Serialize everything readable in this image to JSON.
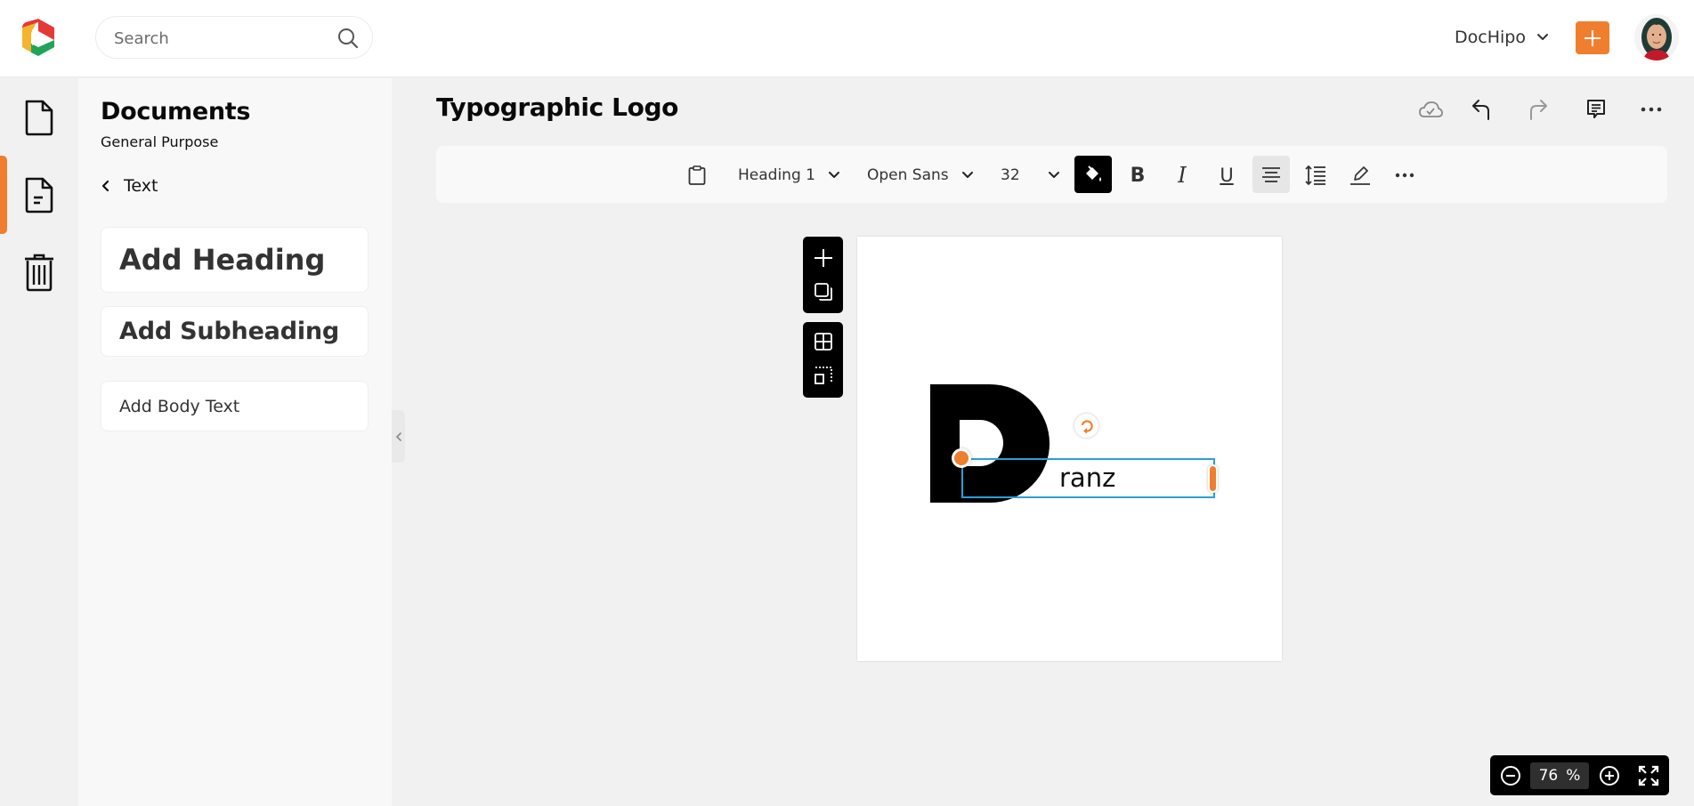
{
  "header": {
    "app_name": "DocHipo",
    "search_placeholder": "Search",
    "workspace_label": "DocHipo",
    "add_button_label": "+",
    "brand_colors": {
      "red": "#e53935",
      "yellow": "#f4b42c",
      "green": "#21a45a",
      "accent": "#ef7f2e"
    }
  },
  "rail": {
    "items": [
      {
        "name": "documents",
        "icon": "file-icon",
        "active": false
      },
      {
        "name": "templates",
        "icon": "file-text-icon",
        "active": true
      },
      {
        "name": "trash",
        "icon": "trash-icon",
        "active": false
      }
    ]
  },
  "panel": {
    "title": "Documents",
    "subtitle": "General Purpose",
    "back_label": "Text",
    "cards": [
      {
        "label": "Add Heading"
      },
      {
        "label": "Add Subheading"
      },
      {
        "label": "Add Body Text"
      }
    ]
  },
  "main": {
    "title": "Typographic Logo",
    "actions": [
      {
        "name": "cloud-saved",
        "icon": "cloud-check-icon"
      },
      {
        "name": "undo",
        "icon": "undo-icon"
      },
      {
        "name": "redo",
        "icon": "redo-icon",
        "disabled": true
      },
      {
        "name": "comments",
        "icon": "comment-icon"
      },
      {
        "name": "more",
        "icon": "more-horizontal-icon"
      }
    ]
  },
  "toolbar": {
    "paste_icon": "clipboard-icon",
    "text_style": "Heading 1",
    "font_family": "Open Sans",
    "font_size": "32",
    "fill_color_active": true,
    "bold": "B",
    "italic": "I",
    "underline": "U",
    "align": "center",
    "line_spacing_icon": "line-height-icon",
    "highlight_icon": "pen-icon",
    "more_icon": "more-horizontal-icon"
  },
  "canvas": {
    "logo_letter_shape": "D",
    "selected_text": "ranz",
    "selection_color": "#2a9fd8",
    "handle_color": "#ef7f2e"
  },
  "side_tools": [
    {
      "name": "add",
      "icon": "plus-icon"
    },
    {
      "name": "duplicate",
      "icon": "duplicate-icon"
    },
    {
      "name": "grid",
      "icon": "grid-icon"
    },
    {
      "name": "select-area",
      "icon": "selection-icon"
    }
  ],
  "zoom": {
    "value": "76",
    "unit": "%"
  }
}
